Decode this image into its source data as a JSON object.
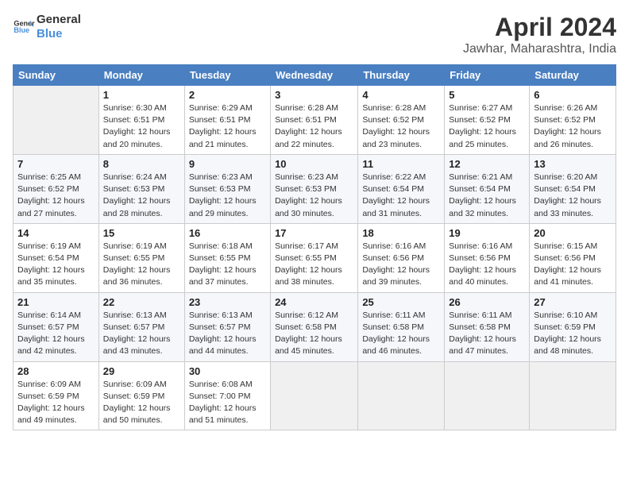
{
  "header": {
    "logo_line1": "General",
    "logo_line2": "Blue",
    "month": "April 2024",
    "location": "Jawhar, Maharashtra, India"
  },
  "weekdays": [
    "Sunday",
    "Monday",
    "Tuesday",
    "Wednesday",
    "Thursday",
    "Friday",
    "Saturday"
  ],
  "weeks": [
    [
      {
        "day": "",
        "info": ""
      },
      {
        "day": "1",
        "info": "Sunrise: 6:30 AM\nSunset: 6:51 PM\nDaylight: 12 hours\nand 20 minutes."
      },
      {
        "day": "2",
        "info": "Sunrise: 6:29 AM\nSunset: 6:51 PM\nDaylight: 12 hours\nand 21 minutes."
      },
      {
        "day": "3",
        "info": "Sunrise: 6:28 AM\nSunset: 6:51 PM\nDaylight: 12 hours\nand 22 minutes."
      },
      {
        "day": "4",
        "info": "Sunrise: 6:28 AM\nSunset: 6:52 PM\nDaylight: 12 hours\nand 23 minutes."
      },
      {
        "day": "5",
        "info": "Sunrise: 6:27 AM\nSunset: 6:52 PM\nDaylight: 12 hours\nand 25 minutes."
      },
      {
        "day": "6",
        "info": "Sunrise: 6:26 AM\nSunset: 6:52 PM\nDaylight: 12 hours\nand 26 minutes."
      }
    ],
    [
      {
        "day": "7",
        "info": "Sunrise: 6:25 AM\nSunset: 6:52 PM\nDaylight: 12 hours\nand 27 minutes."
      },
      {
        "day": "8",
        "info": "Sunrise: 6:24 AM\nSunset: 6:53 PM\nDaylight: 12 hours\nand 28 minutes."
      },
      {
        "day": "9",
        "info": "Sunrise: 6:23 AM\nSunset: 6:53 PM\nDaylight: 12 hours\nand 29 minutes."
      },
      {
        "day": "10",
        "info": "Sunrise: 6:23 AM\nSunset: 6:53 PM\nDaylight: 12 hours\nand 30 minutes."
      },
      {
        "day": "11",
        "info": "Sunrise: 6:22 AM\nSunset: 6:54 PM\nDaylight: 12 hours\nand 31 minutes."
      },
      {
        "day": "12",
        "info": "Sunrise: 6:21 AM\nSunset: 6:54 PM\nDaylight: 12 hours\nand 32 minutes."
      },
      {
        "day": "13",
        "info": "Sunrise: 6:20 AM\nSunset: 6:54 PM\nDaylight: 12 hours\nand 33 minutes."
      }
    ],
    [
      {
        "day": "14",
        "info": "Sunrise: 6:19 AM\nSunset: 6:54 PM\nDaylight: 12 hours\nand 35 minutes."
      },
      {
        "day": "15",
        "info": "Sunrise: 6:19 AM\nSunset: 6:55 PM\nDaylight: 12 hours\nand 36 minutes."
      },
      {
        "day": "16",
        "info": "Sunrise: 6:18 AM\nSunset: 6:55 PM\nDaylight: 12 hours\nand 37 minutes."
      },
      {
        "day": "17",
        "info": "Sunrise: 6:17 AM\nSunset: 6:55 PM\nDaylight: 12 hours\nand 38 minutes."
      },
      {
        "day": "18",
        "info": "Sunrise: 6:16 AM\nSunset: 6:56 PM\nDaylight: 12 hours\nand 39 minutes."
      },
      {
        "day": "19",
        "info": "Sunrise: 6:16 AM\nSunset: 6:56 PM\nDaylight: 12 hours\nand 40 minutes."
      },
      {
        "day": "20",
        "info": "Sunrise: 6:15 AM\nSunset: 6:56 PM\nDaylight: 12 hours\nand 41 minutes."
      }
    ],
    [
      {
        "day": "21",
        "info": "Sunrise: 6:14 AM\nSunset: 6:57 PM\nDaylight: 12 hours\nand 42 minutes."
      },
      {
        "day": "22",
        "info": "Sunrise: 6:13 AM\nSunset: 6:57 PM\nDaylight: 12 hours\nand 43 minutes."
      },
      {
        "day": "23",
        "info": "Sunrise: 6:13 AM\nSunset: 6:57 PM\nDaylight: 12 hours\nand 44 minutes."
      },
      {
        "day": "24",
        "info": "Sunrise: 6:12 AM\nSunset: 6:58 PM\nDaylight: 12 hours\nand 45 minutes."
      },
      {
        "day": "25",
        "info": "Sunrise: 6:11 AM\nSunset: 6:58 PM\nDaylight: 12 hours\nand 46 minutes."
      },
      {
        "day": "26",
        "info": "Sunrise: 6:11 AM\nSunset: 6:58 PM\nDaylight: 12 hours\nand 47 minutes."
      },
      {
        "day": "27",
        "info": "Sunrise: 6:10 AM\nSunset: 6:59 PM\nDaylight: 12 hours\nand 48 minutes."
      }
    ],
    [
      {
        "day": "28",
        "info": "Sunrise: 6:09 AM\nSunset: 6:59 PM\nDaylight: 12 hours\nand 49 minutes."
      },
      {
        "day": "29",
        "info": "Sunrise: 6:09 AM\nSunset: 6:59 PM\nDaylight: 12 hours\nand 50 minutes."
      },
      {
        "day": "30",
        "info": "Sunrise: 6:08 AM\nSunset: 7:00 PM\nDaylight: 12 hours\nand 51 minutes."
      },
      {
        "day": "",
        "info": ""
      },
      {
        "day": "",
        "info": ""
      },
      {
        "day": "",
        "info": ""
      },
      {
        "day": "",
        "info": ""
      }
    ]
  ]
}
